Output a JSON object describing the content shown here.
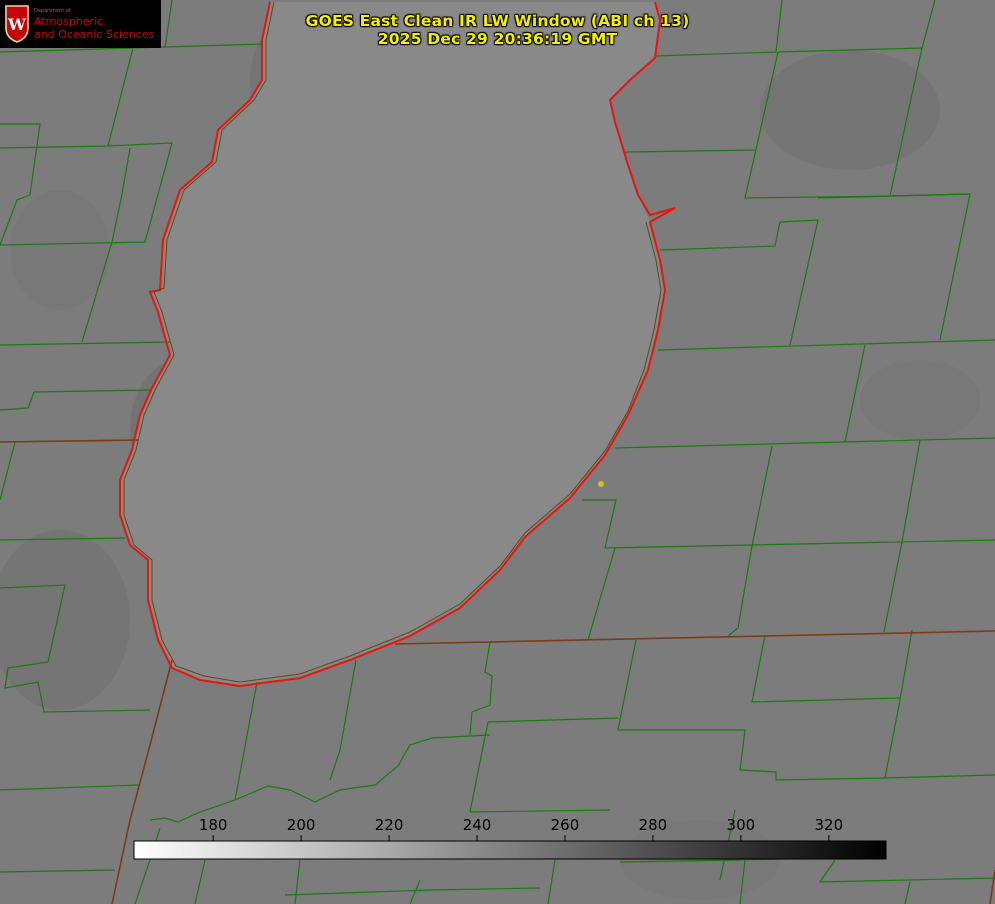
{
  "title": {
    "line1": "GOES East Clean IR LW Window (ABI ch 13)",
    "line2": "2025 Dec 29 20:36:19 GMT"
  },
  "logo": {
    "department": "Department of",
    "line1": "Atmospheric",
    "line2": "and Oceanic Sciences",
    "crest_letter": "W"
  },
  "colorbar": {
    "ticks": [
      "180",
      "200",
      "220",
      "240",
      "260",
      "280",
      "300",
      "320"
    ],
    "range": [
      162,
      333
    ],
    "gradient": [
      "#ffffff",
      "#000000"
    ]
  },
  "colors": {
    "background": "#7c7c7c",
    "lake": "#898989",
    "county_lines": "#1a7a10",
    "shoreline": "#e8140c",
    "state_line": "#7a3c18",
    "marker": "#d4c020",
    "title": "#f5f000"
  },
  "icons": {
    "logo": "uw-crest-icon",
    "marker": "station-dot-icon"
  }
}
